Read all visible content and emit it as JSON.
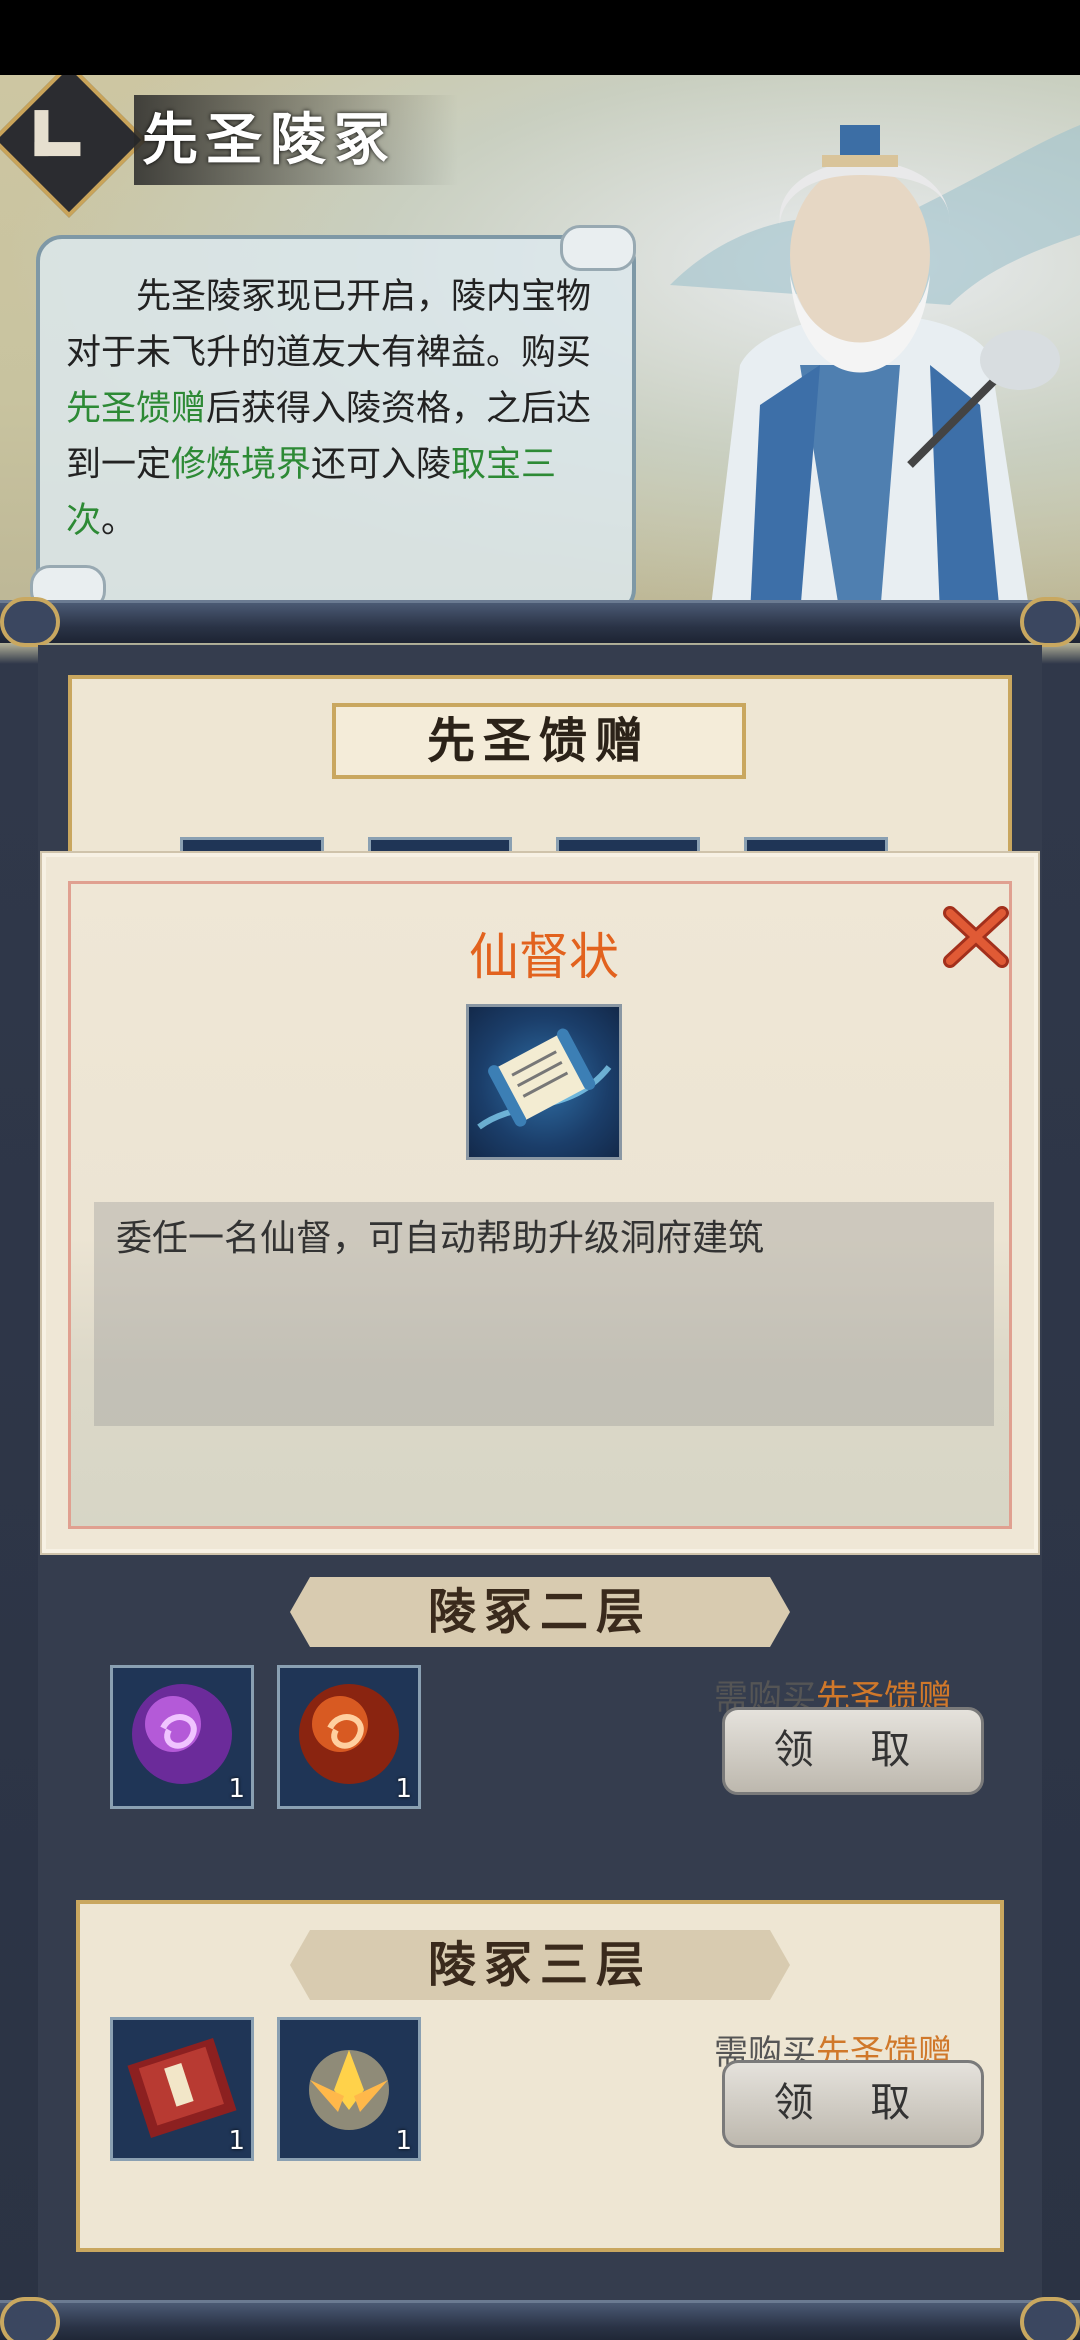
{
  "header": {
    "title": "先圣陵冢",
    "back_icon": "back-chevron-icon"
  },
  "intro": {
    "line_a": "先圣陵冢现已开启，陵内宝物对于未飞升的道友大有裨益。购买",
    "hl1": "先圣馈赠",
    "line_b": "后获得入陵资格，之后达到一定",
    "hl2": "修炼境界",
    "line_c": "还可入陵",
    "hl3": "取宝三次",
    "line_d": "。"
  },
  "gift_section": {
    "title": "先圣馈赠"
  },
  "tiers": [
    {
      "title": "陵冢二层",
      "requirement_prefix": "需购买",
      "requirement_item": "先圣馈赠",
      "claim_label": "领 取",
      "items": [
        {
          "icon": "purple-orb-icon",
          "count": "1"
        },
        {
          "icon": "red-orb-icon",
          "count": "1"
        }
      ]
    },
    {
      "title": "陵冢三层",
      "requirement_prefix": "需购买",
      "requirement_item": "先圣馈赠",
      "claim_label": "领 取",
      "items": [
        {
          "icon": "book-icon",
          "count": "1"
        },
        {
          "icon": "lotus-icon",
          "count": "1"
        }
      ]
    }
  ],
  "popup": {
    "title": "仙督状",
    "icon": "scroll-icon",
    "description": "委任一名仙督，可自动帮助升级洞府建筑",
    "close_icon": "close-x-icon"
  },
  "colors": {
    "highlight_green": "#2d8a35",
    "highlight_orange": "#d0782a",
    "popup_title": "#e2621e",
    "close_red": "#d9482b"
  }
}
